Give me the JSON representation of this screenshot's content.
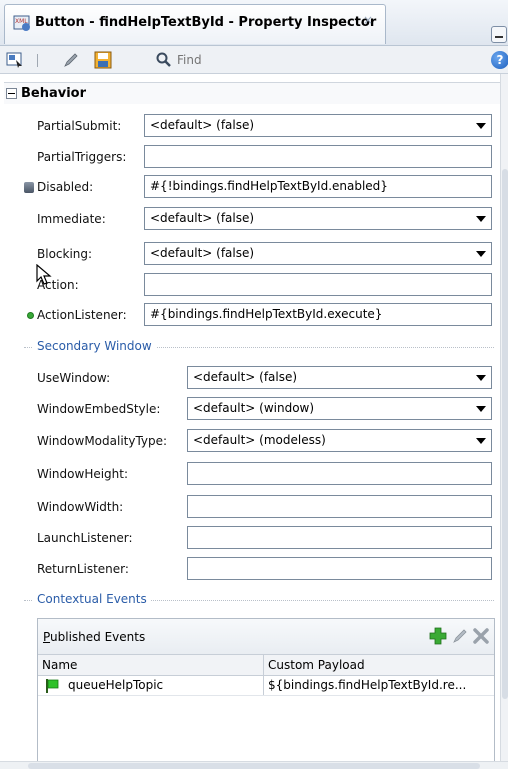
{
  "window": {
    "tab_title": "Button - findHelpTextById - Property Inspector",
    "tab_close": "×"
  },
  "toolbar": {
    "find_placeholder": "Find",
    "help_label": "?"
  },
  "behavior": {
    "section_label": "Behavior",
    "fields": {
      "partial_submit": {
        "label": "PartialSubmit:",
        "value": "<default> (false)"
      },
      "partial_triggers": {
        "label": "PartialTriggers:",
        "value": ""
      },
      "disabled": {
        "label": "Disabled:",
        "value": "#{!bindings.findHelpTextById.enabled}"
      },
      "immediate": {
        "label": "Immediate:",
        "value": "<default> (false)"
      },
      "blocking": {
        "label": "Blocking:",
        "value": "<default> (false)"
      },
      "action": {
        "label": "Action:",
        "value": ""
      },
      "action_listener": {
        "label": "ActionListener:",
        "value": "#{bindings.findHelpTextById.execute}"
      }
    }
  },
  "secondary_window": {
    "group_label": "Secondary Window",
    "fields": {
      "use_window": {
        "label": "UseWindow:",
        "value": "<default> (false)"
      },
      "window_embed_style": {
        "label": "WindowEmbedStyle:",
        "value": "<default> (window)"
      },
      "window_modality_type": {
        "label": "WindowModalityType:",
        "value": "<default> (modeless)"
      },
      "window_height": {
        "label": "WindowHeight:",
        "value": ""
      },
      "window_width": {
        "label": "WindowWidth:",
        "value": ""
      },
      "launch_listener": {
        "label": "LaunchListener:",
        "value": ""
      },
      "return_listener": {
        "label": "ReturnListener:",
        "value": ""
      }
    }
  },
  "contextual_events": {
    "group_label": "Contextual Events",
    "published_events": {
      "title_first": "P",
      "title_rest": "ublished Events",
      "columns": {
        "name": "Name",
        "payload": "Custom Payload"
      },
      "rows": [
        {
          "name": "queueHelpTopic",
          "payload": "${bindings.findHelpTextById.re..."
        }
      ]
    }
  },
  "colors": {
    "accent_blue": "#2a5ca8",
    "add_green": "#3aaa35",
    "border": "#7a8a9c"
  },
  "icons": [
    "xml-component-icon",
    "select-tool-icon",
    "pencil-icon",
    "save-icon",
    "search-icon",
    "help-icon",
    "add-icon",
    "edit-icon",
    "delete-icon",
    "flag-icon",
    "disabled-marker-icon",
    "bound-dot-icon",
    "mouse-cursor-icon"
  ]
}
